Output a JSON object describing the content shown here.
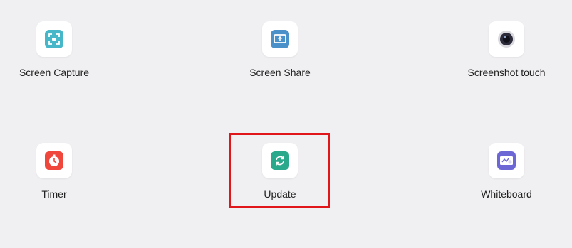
{
  "apps": [
    {
      "label": "Screen Capture",
      "icon": "screen-capture-icon",
      "color": "#46b7c9"
    },
    {
      "label": "Screen Share",
      "icon": "screen-share-icon",
      "color": "#4a90c9"
    },
    {
      "label": "Screenshot touch",
      "icon": "screenshot-touch-icon",
      "color": "#2b2b3a"
    },
    {
      "label": "Timer",
      "icon": "timer-icon",
      "color": "#f0473d"
    },
    {
      "label": "Update",
      "icon": "update-icon",
      "color": "#2aa88c"
    },
    {
      "label": "Whiteboard",
      "icon": "whiteboard-icon",
      "color": "#6d67d6"
    }
  ],
  "highlight_color": "#e0161b"
}
